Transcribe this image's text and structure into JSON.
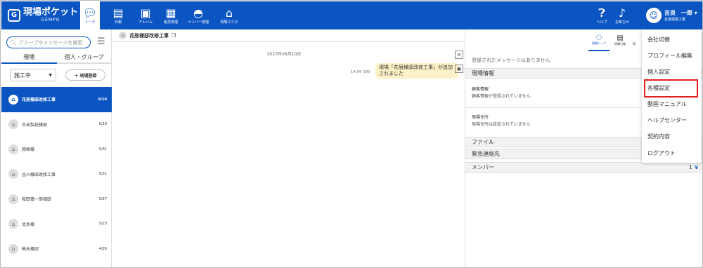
{
  "app": {
    "logo_mark": "G",
    "logo_text": "現場ポケット",
    "logo_sub": "GEMPO"
  },
  "nav": [
    {
      "label": "トーク",
      "icon": "chat-bubble-icon"
    },
    {
      "label": "日報",
      "icon": "document-icon"
    },
    {
      "label": "アルバム",
      "icon": "album-icon"
    },
    {
      "label": "帳票管理",
      "icon": "calculator-icon"
    },
    {
      "label": "メンバー管理",
      "icon": "helmet-icon"
    },
    {
      "label": "現場マスタ",
      "icon": "house-icon"
    }
  ],
  "header_right": {
    "help": "ヘルプ",
    "notice": "お知らせ",
    "user_name": "吉良　一郎",
    "user_company": "吉良建築工業"
  },
  "left": {
    "search_placeholder": "グループやメッセージを検索",
    "tabs": [
      "現場",
      "個人・グループ"
    ],
    "status_select": "施工中",
    "register_button": "＋ 現場登録",
    "sites": [
      {
        "name": "花居様邸改修工事",
        "count": "6/10"
      },
      {
        "name": "古出梨花様邸",
        "count": "6/10"
      },
      {
        "name": "岡崎様",
        "count": "5/31"
      },
      {
        "name": "谷川様邸改修工事",
        "count": "5/31"
      },
      {
        "name": "桜田慎一郎様邸",
        "count": "5/27"
      },
      {
        "name": "北条様",
        "count": "5/23"
      },
      {
        "name": "梅木様邸",
        "count": "4/26"
      }
    ]
  },
  "chat": {
    "title": "花居様邸改修工事",
    "date": "2023年06月10日",
    "message": "現場「花居様邸改修工事」が追加されました",
    "time": "14:34",
    "read_marker": "000"
  },
  "right_panel": {
    "tabs": [
      "現場トーク",
      "現場日報",
      "現"
    ],
    "no_message": "登録されたメッセージはありません",
    "section_info": "現場情報",
    "client_label": "顧客情報",
    "client_value": "顧客情報が登録されていません",
    "address_label": "現場住所",
    "address_value": "現場住所は設定されていません",
    "section_file": "ファイル",
    "section_emergency": "緊急連絡先",
    "section_member": "メンバー",
    "member_count": "1"
  },
  "menu": {
    "items": [
      "会社切替",
      "プロフィール編集",
      "個人設定",
      "各種設定",
      "動画マニュアル",
      "ヘルプセンター",
      "契約内容",
      "ログアウト"
    ],
    "highlighted": "各種設定",
    "highlight_color": "#e02020"
  },
  "colors": {
    "brand": "#0b55c3",
    "bubble": "#fdf1c7"
  }
}
